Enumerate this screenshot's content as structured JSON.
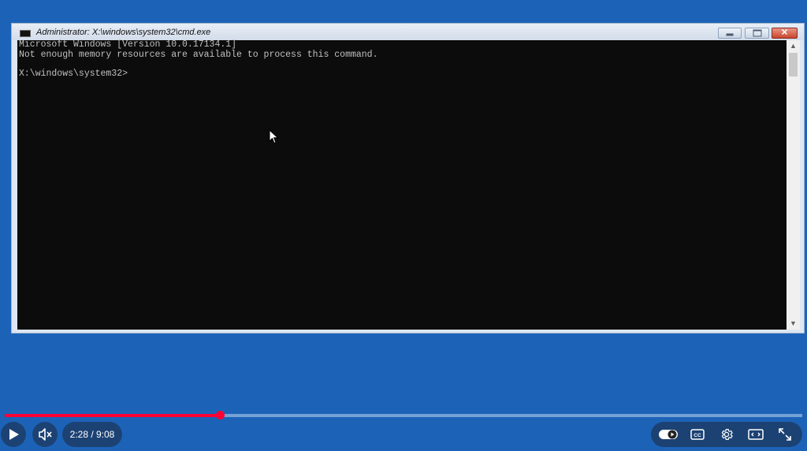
{
  "window": {
    "title": "Administrator: X:\\windows\\system32\\cmd.exe",
    "minimize_label": "",
    "maximize_label": "",
    "close_label": "✕"
  },
  "console": {
    "lines": [
      "Microsoft Windows [Version 10.0.17134.1]",
      "Not enough memory resources are available to process this command.",
      "",
      "X:\\windows\\system32>"
    ]
  },
  "player": {
    "current_time": "2:28",
    "duration": "9:08",
    "time_display": "2:28 / 9:08",
    "progress_fraction": 0.27,
    "icons": [
      "play-icon",
      "mute-icon",
      "autoplay-toggle-icon",
      "captions-icon",
      "settings-icon",
      "theater-mode-icon",
      "fullscreen-icon"
    ],
    "accent_color": "#ff0033"
  }
}
